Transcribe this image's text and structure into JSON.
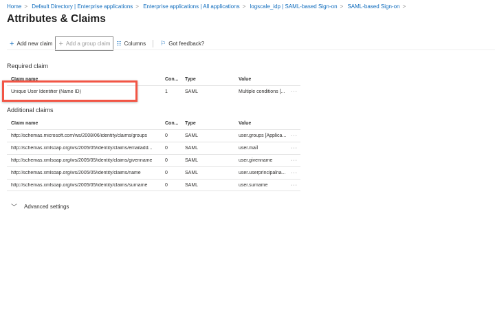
{
  "breadcrumb": [
    "Home",
    "Default Directory | Enterprise applications",
    "Enterprise applications | All applications",
    "logscale_idp | SAML-based Sign-on",
    "SAML-based Sign-on"
  ],
  "title": "Attributes & Claims",
  "more": "···",
  "toolbar": {
    "add_new_claim": "Add new claim",
    "add_group_claim": "Add a group claim",
    "columns": "Columns",
    "feedback": "Got feedback?"
  },
  "columns": {
    "name": "Claim name",
    "con": "Con...",
    "type": "Type",
    "value": "Value"
  },
  "required": {
    "heading": "Required claim",
    "rows": [
      {
        "name": "Unique User Identifier (Name ID)",
        "con": "1",
        "type": "SAML",
        "value": "Multiple conditions [..."
      }
    ]
  },
  "additional": {
    "heading": "Additional claims",
    "rows": [
      {
        "name": "http://schemas.microsoft.com/ws/2008/06/identity/claims/groups",
        "con": "0",
        "type": "SAML",
        "value": "user.groups [Applica..."
      },
      {
        "name": "http://schemas.xmlsoap.org/ws/2005/05/identity/claims/emailadd...",
        "con": "0",
        "type": "SAML",
        "value": "user.mail"
      },
      {
        "name": "http://schemas.xmlsoap.org/ws/2005/05/identity/claims/givenname",
        "con": "0",
        "type": "SAML",
        "value": "user.givenname"
      },
      {
        "name": "http://schemas.xmlsoap.org/ws/2005/05/identity/claims/name",
        "con": "0",
        "type": "SAML",
        "value": "user.userprincipalna..."
      },
      {
        "name": "http://schemas.xmlsoap.org/ws/2005/05/identity/claims/surname",
        "con": "0",
        "type": "SAML",
        "value": "user.surname"
      }
    ]
  },
  "row_menu": "···",
  "advanced": "Advanced settings"
}
